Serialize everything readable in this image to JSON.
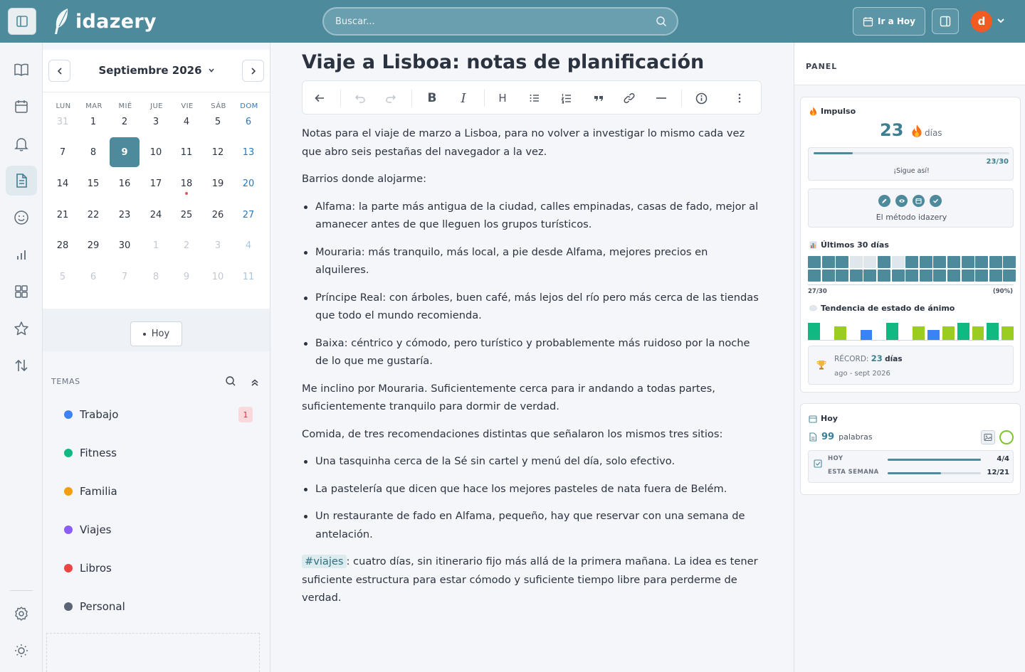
{
  "app": {
    "name": "idazery"
  },
  "header": {
    "search_placeholder": "Buscar...",
    "goto_label": "Ir a Hoy",
    "avatar_letter": "d"
  },
  "rail": [
    "book-icon",
    "calendar-icon",
    "bell-icon",
    "document-icon",
    "smile-icon",
    "bar-chart-icon",
    "grid-icon",
    "star-icon",
    "sort-icon",
    "settings-icon",
    "sun-icon"
  ],
  "calendar": {
    "month": "Septiembre 2026",
    "weekdays": [
      "LUN",
      "MAR",
      "MIÉ",
      "JUE",
      "VIE",
      "SÁB",
      "DOM"
    ],
    "weeks": [
      [
        "31",
        "1",
        "2",
        "3",
        "4",
        "5",
        "6"
      ],
      [
        "7",
        "8",
        "9",
        "10",
        "11",
        "12",
        "13"
      ],
      [
        "14",
        "15",
        "16",
        "17",
        "18",
        "19",
        "20"
      ],
      [
        "21",
        "22",
        "23",
        "24",
        "25",
        "26",
        "27"
      ],
      [
        "28",
        "29",
        "30",
        "1",
        "2",
        "3",
        "4"
      ],
      [
        "5",
        "6",
        "7",
        "8",
        "9",
        "10",
        "11"
      ]
    ],
    "selected_day": "9",
    "today_button": "Hoy"
  },
  "topics": {
    "title": "TEMAS",
    "items": [
      {
        "label": "Trabajo",
        "color": "#3b82f6",
        "badge": "1"
      },
      {
        "label": "Fitness",
        "color": "#10b981",
        "badge": ""
      },
      {
        "label": "Familia",
        "color": "#f59e0b",
        "badge": ""
      },
      {
        "label": "Viajes",
        "color": "#8b5cf6",
        "badge": ""
      },
      {
        "label": "Libros",
        "color": "#ef4444",
        "badge": ""
      },
      {
        "label": "Personal",
        "color": "#5b6475",
        "badge": ""
      }
    ]
  },
  "note": {
    "title": "Viaje a Lisboa: notas de planificación",
    "intro": "Notas para el viaje de marzo a Lisboa, para no volver a investigar lo mismo cada vez que abro seis pestañas del navegador a la vez.",
    "neighborhoods_heading": "Barrios donde alojarme:",
    "neighborhoods": [
      "Alfama: la parte más antigua de la ciudad, calles empinadas, casas de fado, mejor al amanecer antes de que lleguen los grupos turísticos.",
      "Mouraria: más tranquilo, más local, a pie desde Alfama, mejores precios en alquileres.",
      "Príncipe Real: con árboles, buen café, más lejos del río pero más cerca de las tiendas que todo el mundo recomienda.",
      "Baixa: céntrico y cómodo, pero turístico y probablemente más ruidoso por la noche de lo que me gustaría."
    ],
    "decision": "Me inclino por Mouraria. Suficientemente cerca para ir andando a todas partes, suficientemente tranquilo para dormir de verdad.",
    "food_heading": "Comida, de tres recomendaciones distintas que señalaron los mismos tres sitios:",
    "food": [
      "Una tasquinha cerca de la Sé sin cartel y menú del día, solo efectivo.",
      "La pastelería que dicen que hace los mejores pasteles de nata fuera de Belém.",
      "Un restaurante de fado en Alfama, pequeño, hay que reservar con una semana de antelación."
    ],
    "tag": "#viajes",
    "closing": ": cuatro días, sin itinerario fijo más allá de la primera mañana. La idea es tener suficiente estructura para estar cómodo y suficiente tiempo libre para perderme de verdad."
  },
  "panel": {
    "title": "PANEL",
    "streak": {
      "label": "Impulso",
      "value": "23",
      "unit": "días",
      "progress_text": "23/30",
      "progress": 0.2,
      "message": "¡Sigue así!",
      "method": "El método idazery"
    },
    "last30": {
      "label": "Últimos 30 días",
      "cells": [
        1,
        1,
        1,
        0,
        0,
        1,
        0,
        1,
        1,
        1,
        1,
        1,
        1,
        1,
        1,
        1,
        1,
        1,
        1,
        1,
        1,
        1,
        1,
        1,
        1,
        1,
        1,
        1,
        1,
        1
      ],
      "count_text": "27/30",
      "percent_text": "(90%)"
    },
    "mood": {
      "label": "Tendencia de estado de ánimo",
      "bars": [
        {
          "color": "#10b981",
          "value": 1.0
        },
        {
          "color": "#9acd1f",
          "value": 0.8
        },
        {
          "color": "#3b82f6",
          "value": 0.6
        },
        {
          "color": "#10b981",
          "value": 1.0
        },
        {
          "color": "#9acd1f",
          "value": 0.8
        },
        {
          "color": "#3b82f6",
          "value": 0.6
        },
        {
          "color": "#9acd1f",
          "value": 0.8
        },
        {
          "color": "#10b981",
          "value": 1.0
        },
        {
          "color": "#9acd1f",
          "value": 0.8
        },
        {
          "color": "#10b981",
          "value": 1.0
        },
        {
          "color": "#9acd1f",
          "value": 0.8
        }
      ]
    },
    "record": {
      "label": "RÉCORD:",
      "value": "23",
      "unit": "días",
      "range": "ago - sept 2026"
    },
    "today": {
      "label": "Hoy",
      "words": "99",
      "words_label": "palabras",
      "rows": [
        {
          "label": "HOY",
          "value": "4/4",
          "progress": 1.0
        },
        {
          "label": "ESTA SEMANA",
          "value": "12/21",
          "progress": 0.57
        }
      ]
    }
  }
}
